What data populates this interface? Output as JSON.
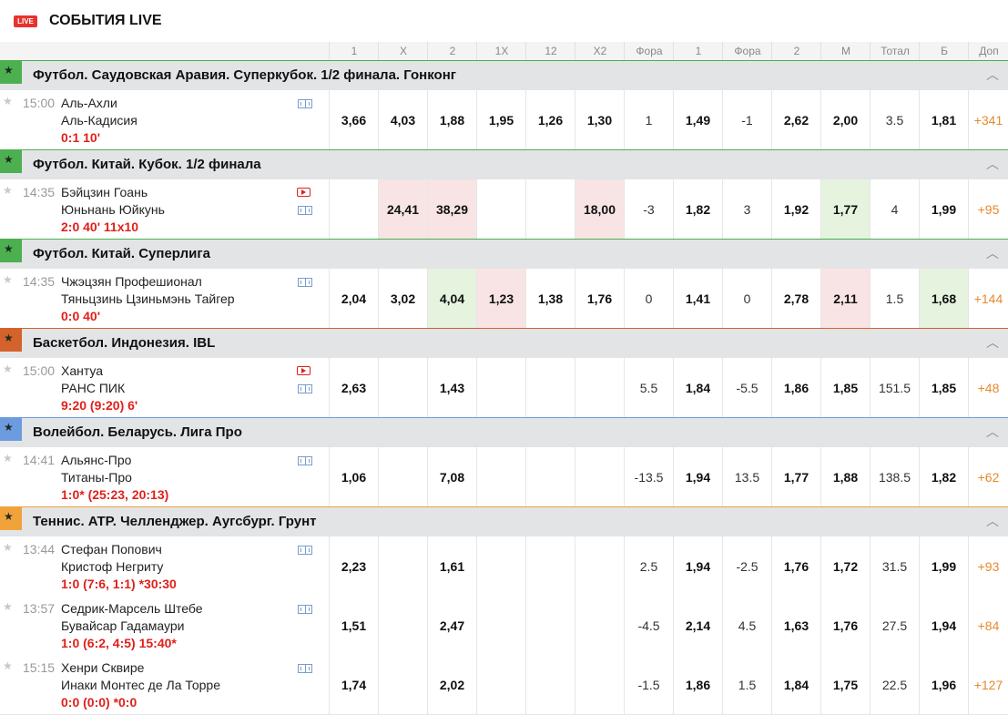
{
  "header": {
    "badge": "LIVE",
    "title": "СОБЫТИЯ LIVE"
  },
  "columns": [
    "1",
    "X",
    "2",
    "1X",
    "12",
    "X2",
    "Фора",
    "1",
    "Фора",
    "2",
    "М",
    "Тотал",
    "Б",
    "Доп"
  ],
  "leagues": [
    {
      "name": "Футбол. Саудовская Аравия. Суперкубок. 1/2 финала. Гонконг",
      "sport": "football",
      "color": "#4caf50",
      "matches": [
        {
          "time": "15:00",
          "team1": "Аль-Ахли",
          "team2": "Аль-Кадисия",
          "score": "0:1 10'",
          "video": false,
          "odds": [
            "3,66",
            "4,03",
            "1,88",
            "1,95",
            "1,26",
            "1,30",
            "1",
            "1,49",
            "-1",
            "2,62",
            "2,00",
            "3.5",
            "1,81",
            "+341"
          ],
          "hl": [
            "",
            "",
            "",
            "",
            "",
            "",
            "",
            "",
            "",
            "",
            "",
            "",
            "",
            ""
          ]
        }
      ]
    },
    {
      "name": "Футбол. Китай. Кубок. 1/2 финала",
      "sport": "football",
      "color": "#4caf50",
      "matches": [
        {
          "time": "14:35",
          "team1": "Бэйцзин Гоань",
          "team2": "Юньнань Юйкунь",
          "score": "2:0 40' 11x10",
          "video": true,
          "odds": [
            "",
            "24,41",
            "38,29",
            "",
            "",
            "18,00",
            "-3",
            "1,82",
            "3",
            "1,92",
            "1,77",
            "4",
            "1,99",
            "+95"
          ],
          "hl": [
            "",
            "red",
            "red",
            "",
            "",
            "red",
            "",
            "",
            "",
            "",
            "green",
            "",
            "",
            ""
          ]
        }
      ]
    },
    {
      "name": "Футбол. Китай. Суперлига",
      "sport": "football",
      "color": "#4caf50",
      "matches": [
        {
          "time": "14:35",
          "team1": "Чжэцзян Профешионал",
          "team2": "Тяньцзинь Цзиньмэнь Тайгер",
          "score": "0:0 40'",
          "video": false,
          "odds": [
            "2,04",
            "3,02",
            "4,04",
            "1,23",
            "1,38",
            "1,76",
            "0",
            "1,41",
            "0",
            "2,78",
            "2,11",
            "1.5",
            "1,68",
            "+144"
          ],
          "hl": [
            "",
            "",
            "green",
            "red",
            "",
            "",
            "",
            "",
            "",
            "",
            "red",
            "",
            "green",
            ""
          ]
        }
      ]
    },
    {
      "name": "Баскетбол. Индонезия. IBL",
      "sport": "basketball",
      "color": "#d4622b",
      "matches": [
        {
          "time": "15:00",
          "team1": "Хантуа",
          "team2": "РАНС ПИК",
          "score": "9:20 (9:20) 6'",
          "video": true,
          "odds": [
            "2,63",
            "",
            "1,43",
            "",
            "",
            "",
            "5.5",
            "1,84",
            "-5.5",
            "1,86",
            "1,85",
            "151.5",
            "1,85",
            "+48"
          ],
          "hl": [
            "",
            "",
            "",
            "",
            "",
            "",
            "",
            "",
            "",
            "",
            "",
            "",
            "",
            ""
          ]
        }
      ]
    },
    {
      "name": "Волейбол. Беларусь. Лига Про",
      "sport": "volleyball",
      "color": "#6d9be0",
      "matches": [
        {
          "time": "14:41",
          "team1": "Альянс-Про",
          "team2": "Титаны-Про",
          "score": "1:0* (25:23, 20:13)",
          "video": false,
          "odds": [
            "1,06",
            "",
            "7,08",
            "",
            "",
            "",
            "-13.5",
            "1,94",
            "13.5",
            "1,77",
            "1,88",
            "138.5",
            "1,82",
            "+62"
          ],
          "hl": [
            "",
            "",
            "",
            "",
            "",
            "",
            "",
            "",
            "",
            "",
            "",
            "",
            "",
            ""
          ]
        }
      ]
    },
    {
      "name": "Теннис. ATP. Челленджер. Аугсбург. Грунт",
      "sport": "tennis",
      "color": "#f0a33a",
      "matches": [
        {
          "time": "13:44",
          "team1": "Стефан Попович",
          "team2": "Кристоф Негриту",
          "score": "1:0 (7:6, 1:1) *30:30",
          "video": false,
          "odds": [
            "2,23",
            "",
            "1,61",
            "",
            "",
            "",
            "2.5",
            "1,94",
            "-2.5",
            "1,76",
            "1,72",
            "31.5",
            "1,99",
            "+93"
          ],
          "hl": [
            "",
            "",
            "",
            "",
            "",
            "",
            "",
            "",
            "",
            "",
            "",
            "",
            "",
            ""
          ]
        },
        {
          "time": "13:57",
          "team1": "Седрик-Марсель Штебе",
          "team2": "Бувайсар Гадамаури",
          "score": "1:0 (6:2, 4:5) 15:40*",
          "video": false,
          "odds": [
            "1,51",
            "",
            "2,47",
            "",
            "",
            "",
            "-4.5",
            "2,14",
            "4.5",
            "1,63",
            "1,76",
            "27.5",
            "1,94",
            "+84"
          ],
          "hl": [
            "",
            "",
            "",
            "",
            "",
            "",
            "",
            "",
            "",
            "",
            "",
            "",
            "",
            ""
          ]
        },
        {
          "time": "15:15",
          "team1": "Хенри Сквире",
          "team2": "Инаки Монтес де Ла Торре",
          "score": "0:0 (0:0) *0:0",
          "video": false,
          "odds": [
            "1,74",
            "",
            "2,02",
            "",
            "",
            "",
            "-1.5",
            "1,86",
            "1.5",
            "1,84",
            "1,75",
            "22.5",
            "1,96",
            "+127"
          ],
          "hl": [
            "",
            "",
            "",
            "",
            "",
            "",
            "",
            "",
            "",
            "",
            "",
            "",
            "",
            ""
          ]
        }
      ]
    }
  ]
}
